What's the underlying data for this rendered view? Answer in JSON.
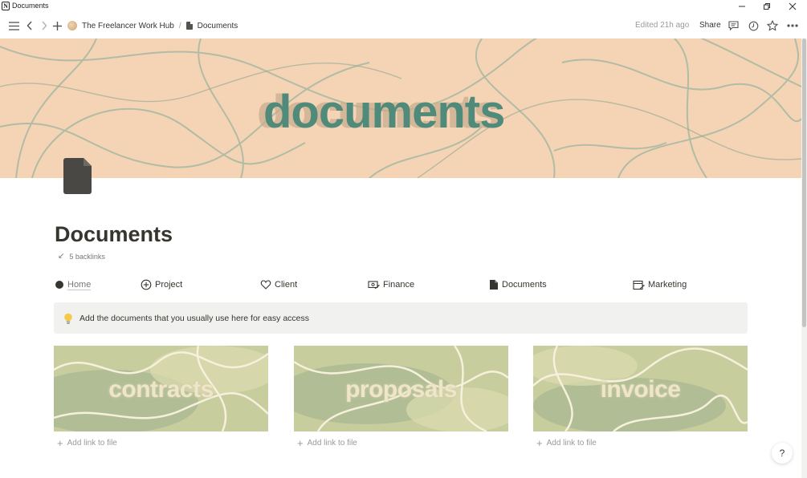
{
  "window": {
    "app_icon": "N",
    "title": "Documents",
    "controls": [
      "minimize-icon",
      "restore-icon",
      "close-icon"
    ]
  },
  "topbar": {
    "breadcrumb": [
      "The Freelancer Work Hub",
      "Documents"
    ],
    "separator": "/",
    "edited": "Edited 21h ago",
    "share_label": "Share",
    "icons": [
      "menu-icon",
      "back-icon",
      "forward-icon",
      "add-icon",
      "comments-icon",
      "updates-icon",
      "favorite-icon",
      "more-icon"
    ]
  },
  "cover": {
    "text": "documents",
    "bg_color": "#f5d3b5",
    "text_color": "#4f8a7a"
  },
  "page": {
    "title": "Documents",
    "backlinks": "5 backlinks",
    "nav": [
      {
        "label": "Home",
        "icon": "circle-icon"
      },
      {
        "label": "Project",
        "icon": "plus-circle-icon"
      },
      {
        "label": "Client",
        "icon": "heart-chat-icon"
      },
      {
        "label": "Finance",
        "icon": "money-arrow-icon"
      },
      {
        "label": "Documents",
        "icon": "document-icon"
      },
      {
        "label": "Marketing",
        "icon": "calendar-arrow-icon"
      }
    ],
    "callout": {
      "icon": "lightbulb-icon",
      "text": "Add the documents that you usually use here for easy access"
    },
    "cards": [
      {
        "label": "contracts",
        "action": "Add link to file"
      },
      {
        "label": "proposals",
        "action": "Add link to file"
      },
      {
        "label": "invoice",
        "action": "Add link to file"
      }
    ]
  },
  "help": "?"
}
